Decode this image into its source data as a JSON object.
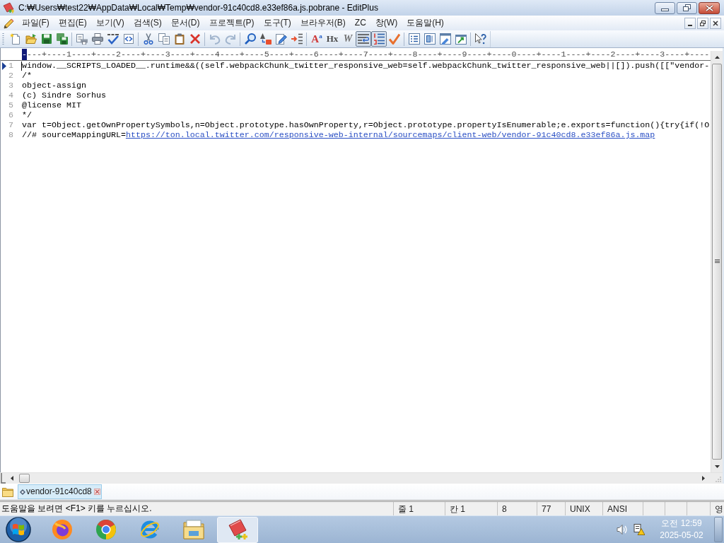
{
  "window": {
    "title": "C:₩Users₩test22₩AppData₩Local₩Temp₩vendor-91c40cd8.e33ef86a.js.pobrane - EditPlus"
  },
  "menu": [
    "파일(F)",
    "편집(E)",
    "보기(V)",
    "검색(S)",
    "문서(D)",
    "프로젝트(P)",
    "도구(T)",
    "브라우저(B)",
    "ZC",
    "창(W)",
    "도움말(H)"
  ],
  "toolbar": [
    [
      {
        "kind": "icon",
        "pressed": false,
        "disabled": false
      },
      {
        "kind": "icon",
        "pressed": false,
        "disabled": false
      },
      {
        "kind": "icon",
        "pressed": false,
        "disabled": false
      },
      {
        "kind": "icon",
        "pressed": false,
        "disabled": false
      }
    ],
    [
      {
        "kind": "icon",
        "pressed": false,
        "disabled": false
      },
      {
        "kind": "icon",
        "pressed": false,
        "disabled": false
      },
      {
        "kind": "icon",
        "pressed": false,
        "disabled": false
      },
      {
        "kind": "icon",
        "pressed": false,
        "disabled": false
      }
    ],
    [
      {
        "kind": "icon",
        "pressed": false,
        "disabled": false
      },
      {
        "kind": "icon",
        "pressed": false,
        "disabled": false
      },
      {
        "kind": "icon",
        "pressed": false,
        "disabled": false
      },
      {
        "kind": "icon",
        "pressed": false,
        "disabled": false
      }
    ],
    [
      {
        "kind": "icon",
        "pressed": false,
        "disabled": true
      },
      {
        "kind": "icon",
        "pressed": false,
        "disabled": true
      }
    ],
    [
      {
        "kind": "icon",
        "pressed": false,
        "disabled": false
      },
      {
        "kind": "icon",
        "pressed": false,
        "disabled": false
      },
      {
        "kind": "icon",
        "pressed": false,
        "disabled": false
      },
      {
        "kind": "icon",
        "pressed": false,
        "disabled": false
      }
    ],
    [
      {
        "kind": "glyph",
        "label": "A$^{a}$",
        "pressed": false,
        "disabled": false
      },
      {
        "kind": "glyph",
        "label": "Hx",
        "pressed": false,
        "disabled": false
      },
      {
        "kind": "glyph",
        "label": "W",
        "pressed": false,
        "disabled": false
      },
      {
        "kind": "icon",
        "pressed": true,
        "disabled": false
      },
      {
        "kind": "icon",
        "pressed": true,
        "disabled": false
      },
      {
        "kind": "icon",
        "pressed": false,
        "disabled": false
      }
    ],
    [
      {
        "kind": "icon",
        "pressed": false,
        "disabled": false
      },
      {
        "kind": "icon",
        "pressed": false,
        "disabled": false
      },
      {
        "kind": "icon",
        "pressed": false,
        "disabled": false
      },
      {
        "kind": "icon",
        "pressed": false,
        "disabled": false
      }
    ],
    [
      {
        "kind": "icon",
        "pressed": false,
        "disabled": false
      }
    ]
  ],
  "ruler": {
    "cursor_mark": "-",
    "text": "---+----1----+----2----+----3----+----4----+----5----+----6----+----7----+----8----+----9----+----0----+----1----+----2----+----3----+----"
  },
  "lines": [
    {
      "number": "1",
      "text": "window.__SCRIPTS_LOADED__.runtime&&((self.webpackChunk_twitter_responsive_web=self.webpackChunk_twitter_responsive_web||[]).push([[\"vendor-",
      "current": true
    },
    {
      "number": "2",
      "text": "/*",
      "current": false
    },
    {
      "number": "3",
      "text": "object-assign",
      "current": false
    },
    {
      "number": "4",
      "text": "(c) Sindre Sorhus",
      "current": false
    },
    {
      "number": "5",
      "text": "@license MIT",
      "current": false
    },
    {
      "number": "6",
      "text": "*/",
      "current": false
    },
    {
      "number": "7",
      "text": "var t=Object.getOwnPropertySymbols,n=Object.prototype.hasOwnProperty,r=Object.prototype.propertyIsEnumerable;e.exports=function(){try{if(!O",
      "current": false
    },
    {
      "number": "8",
      "text": "//# sourceMappingURL=",
      "link": "https://ton.local.twitter.com/responsive-web-internal/sourcemaps/client-web/vendor-91c40cd8.e33ef86a.js.map",
      "current": false
    }
  ],
  "document_tabs": [
    {
      "label": "vendor-91c40cd8",
      "selected": true
    }
  ],
  "status_bar": {
    "message": "도움말을 보려면 <F1> 키를 누르십시오.",
    "panels": [
      "줄 1",
      "칸 1",
      "8",
      "77",
      "UNIX",
      "ANSI"
    ],
    "indicator": "영"
  },
  "taskbar": {
    "apps": [
      {
        "active": false
      },
      {
        "active": false
      },
      {
        "active": false
      },
      {
        "active": false
      },
      {
        "active": true
      }
    ],
    "clock": {
      "time": "오전 12:59",
      "date": "2025-05-02"
    }
  }
}
